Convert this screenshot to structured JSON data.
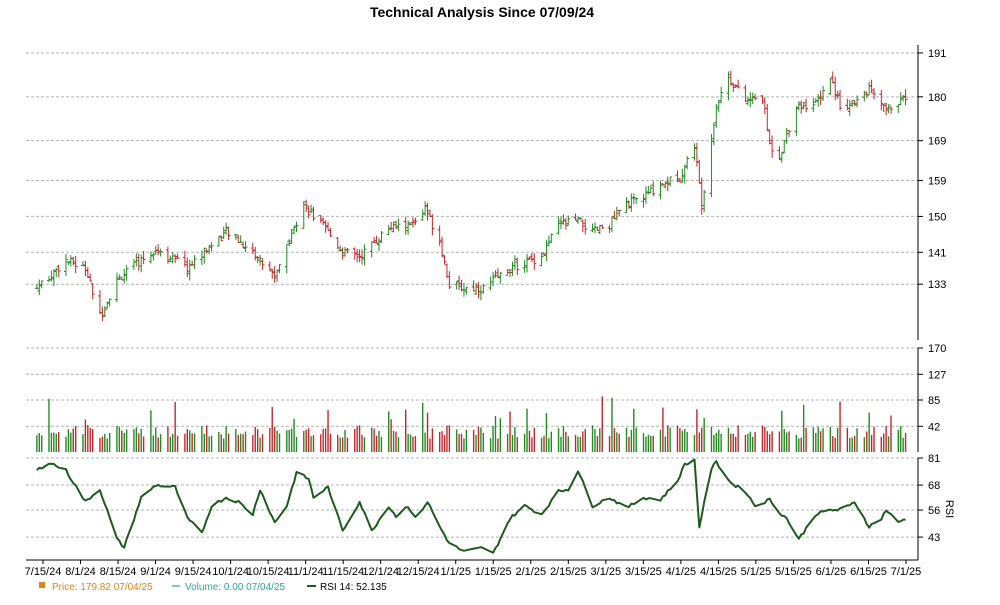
{
  "chart_data": {
    "type": "ohlc",
    "title": "Technical Analysis Since 07/09/24",
    "colors": {
      "up": "#228B22",
      "down": "#c0282d",
      "rsi": "#1e5c1e",
      "grid": "#b4b4b4",
      "price_legend": "#d9861a",
      "volume_legend": "#2aa3a8"
    },
    "x_ticks": [
      "7/15/24",
      "8/1/24",
      "8/15/24",
      "9/1/24",
      "9/15/24",
      "10/1/24",
      "10/15/24",
      "11/1/24",
      "11/15/24",
      "12/1/24",
      "12/15/24",
      "1/1/25",
      "1/15/25",
      "2/1/25",
      "2/15/25",
      "3/1/25",
      "3/15/25",
      "4/1/25",
      "4/15/25",
      "5/1/25",
      "5/15/25",
      "6/1/25",
      "6/15/25",
      "7/1/25"
    ],
    "price_panel": {
      "y_ticks": [
        133,
        141,
        150,
        159,
        169,
        180,
        191
      ],
      "ylim": [
        119,
        193
      ]
    },
    "volume_panel": {
      "y_ticks": [
        42,
        85,
        127,
        170
      ],
      "ylim": [
        0,
        170
      ]
    },
    "rsi_panel": {
      "label": "RSI",
      "y_ticks": [
        43,
        56,
        68,
        81
      ],
      "ylim": [
        32,
        81
      ]
    },
    "price_anchors": {
      "dates": [
        "2024-07-10",
        "2024-07-22",
        "2024-07-30",
        "2024-08-05",
        "2024-08-12",
        "2024-08-28",
        "2024-09-10",
        "2024-09-20",
        "2024-09-26",
        "2024-10-01",
        "2024-10-07",
        "2024-10-16",
        "2024-10-21",
        "2024-10-28",
        "2024-11-01",
        "2024-11-07",
        "2024-11-13",
        "2024-11-20",
        "2024-12-02",
        "2024-12-12",
        "2024-12-17",
        "2024-12-23",
        "2024-12-27",
        "2025-01-02",
        "2025-01-10",
        "2025-01-21",
        "2025-02-03",
        "2025-02-10",
        "2025-02-18",
        "2025-02-24",
        "2025-03-03",
        "2025-03-10",
        "2025-03-17",
        "2025-03-24",
        "2025-04-01",
        "2025-04-07",
        "2025-04-10",
        "2025-04-16",
        "2025-04-21",
        "2025-04-28",
        "2025-05-05",
        "2025-05-08",
        "2025-05-12",
        "2025-05-19",
        "2025-05-27",
        "2025-06-02",
        "2025-06-06",
        "2025-06-12",
        "2025-06-18",
        "2025-06-24",
        "2025-06-30",
        "2025-07-03"
      ],
      "close": [
        132,
        139,
        137,
        125,
        134,
        142,
        137,
        143,
        146,
        144,
        141,
        135,
        143,
        153,
        150,
        146,
        141,
        140,
        147,
        148,
        152,
        144,
        133,
        132,
        132,
        137,
        140,
        148,
        149,
        146,
        148,
        153,
        155,
        158,
        160,
        168,
        153,
        178,
        185,
        179,
        180,
        168,
        165,
        178,
        178,
        185,
        178,
        178,
        182,
        177,
        178,
        180
      ]
    },
    "rsi_anchors": {
      "dates": [
        "2024-07-10",
        "2024-07-15",
        "2024-07-22",
        "2024-07-30",
        "2024-08-05",
        "2024-08-12",
        "2024-08-15",
        "2024-08-22",
        "2024-08-28",
        "2024-09-05",
        "2024-09-10",
        "2024-09-16",
        "2024-09-20",
        "2024-09-26",
        "2024-10-01",
        "2024-10-07",
        "2024-10-10",
        "2024-10-16",
        "2024-10-21",
        "2024-10-25",
        "2024-10-30",
        "2024-11-01",
        "2024-11-07",
        "2024-11-13",
        "2024-11-20",
        "2024-11-25",
        "2024-12-02",
        "2024-12-05",
        "2024-12-10",
        "2024-12-13",
        "2024-12-18",
        "2024-12-23",
        "2024-12-27",
        "2025-01-02",
        "2025-01-06",
        "2025-01-10",
        "2025-01-14",
        "2025-01-21",
        "2025-01-27",
        "2025-02-03",
        "2025-02-10",
        "2025-02-14",
        "2025-02-18",
        "2025-02-24",
        "2025-03-03",
        "2025-03-10",
        "2025-03-17",
        "2025-03-24",
        "2025-03-31",
        "2025-04-03",
        "2025-04-07",
        "2025-04-09",
        "2025-04-14",
        "2025-04-16",
        "2025-04-22",
        "2025-04-28",
        "2025-05-02",
        "2025-05-08",
        "2025-05-12",
        "2025-05-15",
        "2025-05-20",
        "2025-05-27",
        "2025-06-02",
        "2025-06-05",
        "2025-06-10",
        "2025-06-12",
        "2025-06-18",
        "2025-06-23",
        "2025-06-25",
        "2025-06-30",
        "2025-07-03"
      ],
      "values": [
        75,
        79,
        75,
        60,
        66,
        42,
        38,
        62,
        68,
        67,
        52,
        45,
        58,
        62,
        60,
        54,
        66,
        50,
        58,
        74,
        71,
        62,
        67,
        46,
        60,
        46,
        58,
        53,
        58,
        52,
        60,
        48,
        40,
        36,
        37,
        38,
        35,
        52,
        58,
        54,
        65,
        66,
        75,
        58,
        62,
        57,
        62,
        61,
        70,
        78,
        80,
        48,
        76,
        79,
        69,
        65,
        58,
        61,
        55,
        52,
        42,
        54,
        56,
        56,
        58,
        60,
        48,
        52,
        56,
        50,
        52
      ]
    },
    "last_rsi": 52.135
  },
  "legend": {
    "price_text": "Price: 179.82  07/04/25",
    "volume_text": "Volume: 0.00  07/04/25",
    "rsi_text": "RSI 14: 52.135"
  }
}
